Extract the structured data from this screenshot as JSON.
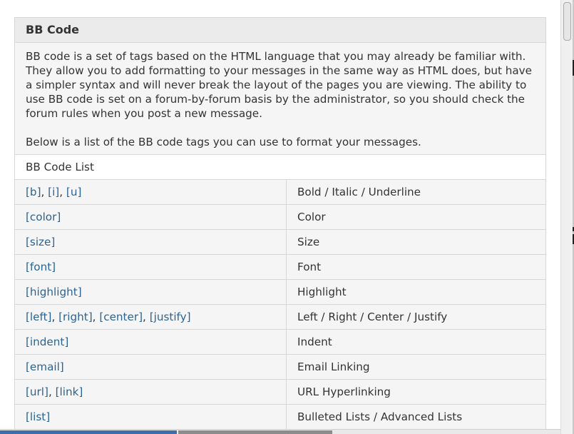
{
  "panel": {
    "title": "BB Code",
    "intro": "BB code is a set of tags based on the HTML language that you may already be familiar with. They allow you to add formatting to your messages in the same way as HTML does, but have a simpler syntax and will never break the layout of the pages you are viewing. The ability to use BB code is set on a forum-by-forum basis by the administrator, so you should check the forum rules when you post a new message.",
    "list_intro": "Below is a list of the BB code tags you can use to format your messages."
  },
  "list": {
    "title": "BB Code List",
    "rows": [
      {
        "codes": [
          "[b]",
          "[i]",
          "[u]"
        ],
        "description": "Bold / Italic / Underline"
      },
      {
        "codes": [
          "[color]"
        ],
        "description": "Color"
      },
      {
        "codes": [
          "[size]"
        ],
        "description": "Size"
      },
      {
        "codes": [
          "[font]"
        ],
        "description": "Font"
      },
      {
        "codes": [
          "[highlight]"
        ],
        "description": "Highlight"
      },
      {
        "codes": [
          "[left]",
          "[right]",
          "[center]",
          "[justify]"
        ],
        "description": "Left / Right / Center / Justify"
      },
      {
        "codes": [
          "[indent]"
        ],
        "description": "Indent"
      },
      {
        "codes": [
          "[email]"
        ],
        "description": "Email Linking"
      },
      {
        "codes": [
          "[url]",
          "[link]"
        ],
        "description": "URL Hyperlinking"
      },
      {
        "codes": [
          "[list]"
        ],
        "description": "Bulleted Lists / Advanced Lists"
      }
    ]
  },
  "colors": {
    "link": "#2a6496",
    "text": "#333333",
    "border": "#d7d7d7",
    "header_bg": "#ebebeb",
    "body_bg": "#f5f5f5"
  }
}
